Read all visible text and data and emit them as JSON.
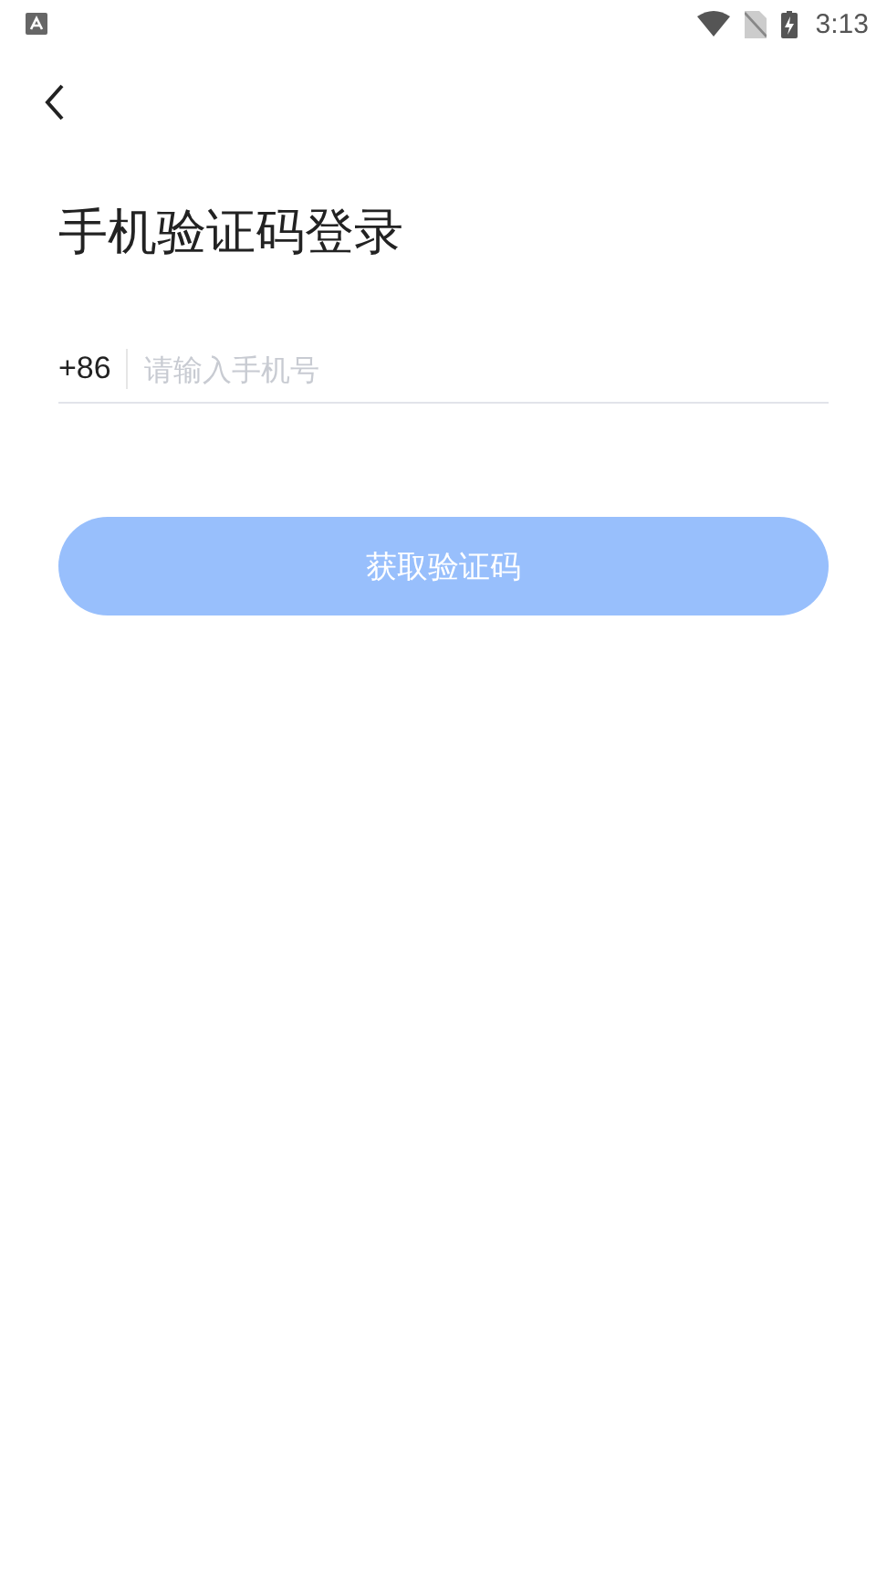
{
  "status_bar": {
    "time": "3:13"
  },
  "title": "手机验证码登录",
  "phone_field": {
    "country_code": "+86",
    "placeholder": "请输入手机号"
  },
  "submit_button": {
    "label": "获取验证码",
    "disabled": true
  }
}
